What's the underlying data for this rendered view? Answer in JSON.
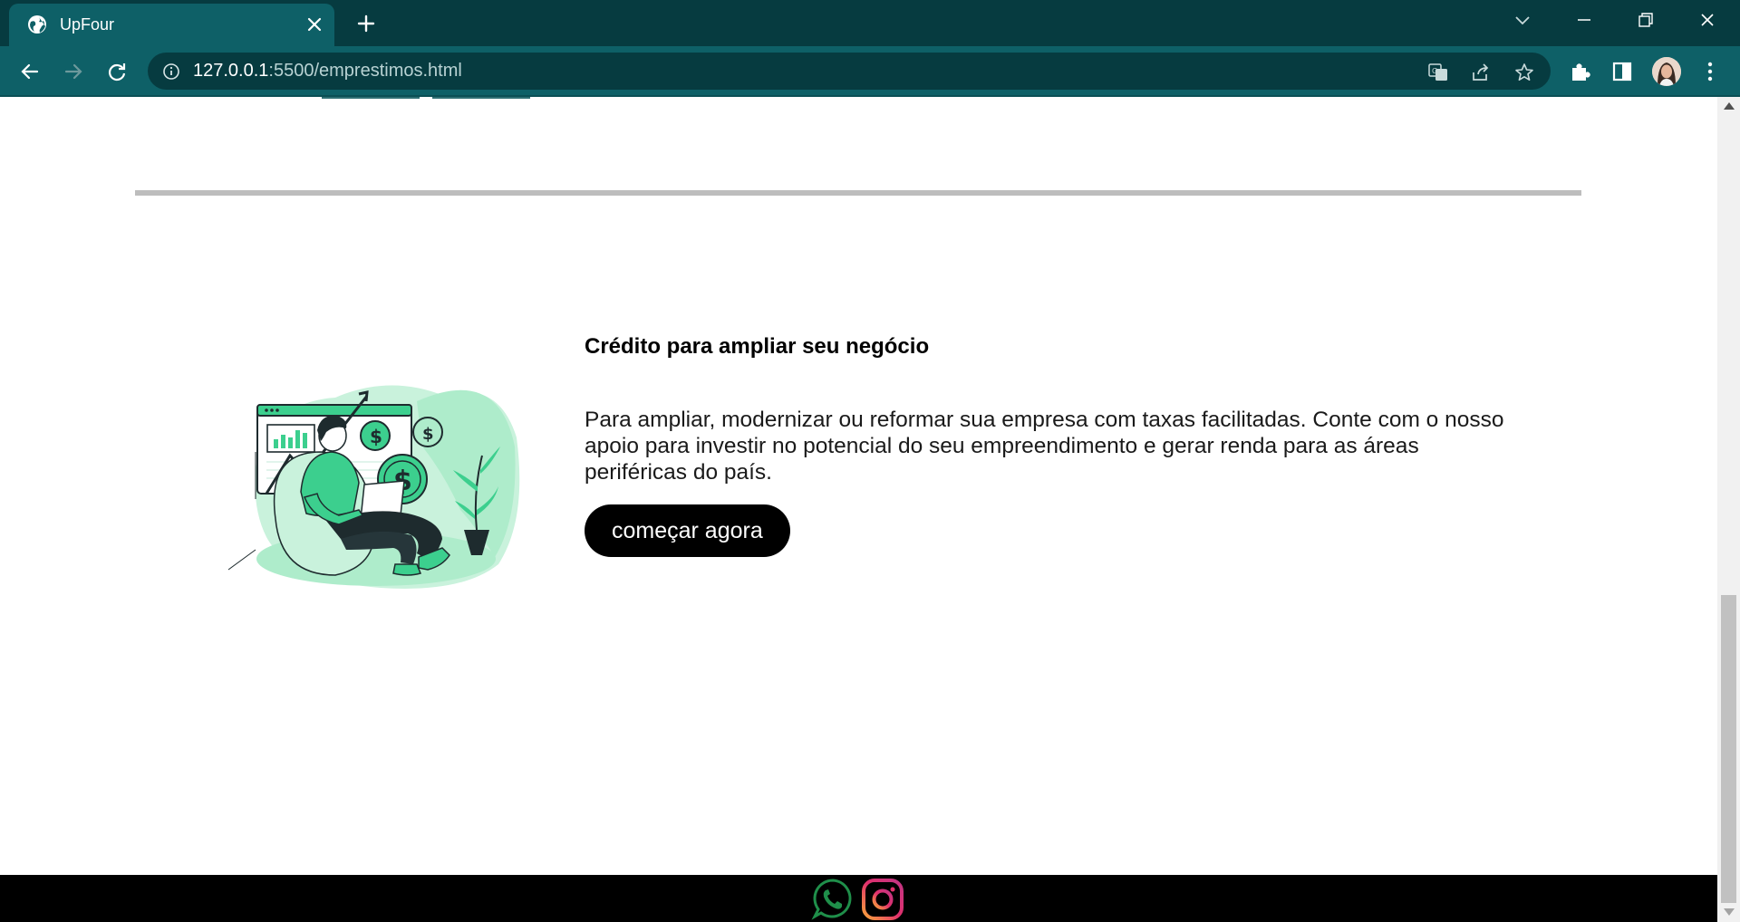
{
  "browser": {
    "tab_title": "UpFour",
    "url_host": "127.0.0.1",
    "url_rest": ":5500/emprestimos.html"
  },
  "section": {
    "heading": "Crédito para ampliar seu negócio",
    "paragraph": "Para ampliar, modernizar ou reformar sua empresa com taxas facilitadas. Conte com o nosso apoio para investir no potencial do seu empreendimento e gerar renda para as áreas periféricas do país.",
    "cta_label": "começar agora"
  },
  "colors": {
    "chrome_dark": "#063b40",
    "chrome_tab": "#0e6067",
    "illustration_green": "#3ccf8e",
    "illustration_light": "#c9f2dc",
    "footer": "#000000",
    "button": "#000000"
  },
  "footer": {
    "icons": [
      "whatsapp-icon",
      "instagram-icon"
    ]
  }
}
